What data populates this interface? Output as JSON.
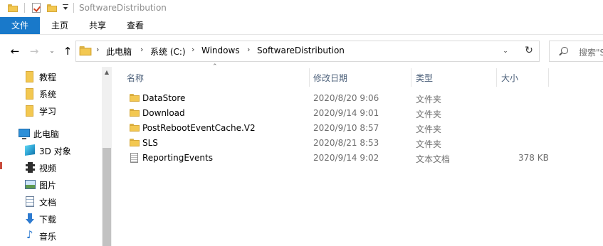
{
  "window": {
    "title": "SoftwareDistribution"
  },
  "ribbon": {
    "tabs": [
      {
        "label": "文件",
        "active": true
      },
      {
        "label": "主页",
        "active": false
      },
      {
        "label": "共享",
        "active": false
      },
      {
        "label": "查看",
        "active": false
      }
    ]
  },
  "address": {
    "crumbs": [
      "此电脑",
      "系统 (C:)",
      "Windows",
      "SoftwareDistribution"
    ]
  },
  "search": {
    "placeholder": "搜索\"S"
  },
  "nav": {
    "items": [
      {
        "label": "教程",
        "icon": "folder-icon"
      },
      {
        "label": "系统",
        "icon": "folder-icon"
      },
      {
        "label": "学习",
        "icon": "folder-icon"
      },
      {
        "label": "此电脑",
        "icon": "computer-icon"
      },
      {
        "label": "3D 对象",
        "icon": "3d-objects-icon"
      },
      {
        "label": "视频",
        "icon": "video-icon"
      },
      {
        "label": "图片",
        "icon": "pictures-icon"
      },
      {
        "label": "文档",
        "icon": "documents-icon"
      },
      {
        "label": "下载",
        "icon": "downloads-icon"
      },
      {
        "label": "音乐",
        "icon": "music-icon"
      }
    ]
  },
  "columns": {
    "name": "名称",
    "date": "修改日期",
    "type": "类型",
    "size": "大小"
  },
  "files": [
    {
      "name": "DataStore",
      "date": "2020/8/20 9:06",
      "type": "文件夹",
      "size": "",
      "icon": "folder-icon"
    },
    {
      "name": "Download",
      "date": "2020/9/14 9:01",
      "type": "文件夹",
      "size": "",
      "icon": "folder-icon"
    },
    {
      "name": "PostRebootEventCache.V2",
      "date": "2020/9/10 8:57",
      "type": "文件夹",
      "size": "",
      "icon": "folder-icon"
    },
    {
      "name": "SLS",
      "date": "2020/8/21 8:53",
      "type": "文件夹",
      "size": "",
      "icon": "folder-icon"
    },
    {
      "name": "ReportingEvents",
      "date": "2020/9/14 9:02",
      "type": "文本文档",
      "size": "378 KB",
      "icon": "text-file-icon"
    }
  ],
  "colors": {
    "accent": "#1979ca",
    "folder": "#f3c851",
    "header_text": "#4c607a"
  }
}
